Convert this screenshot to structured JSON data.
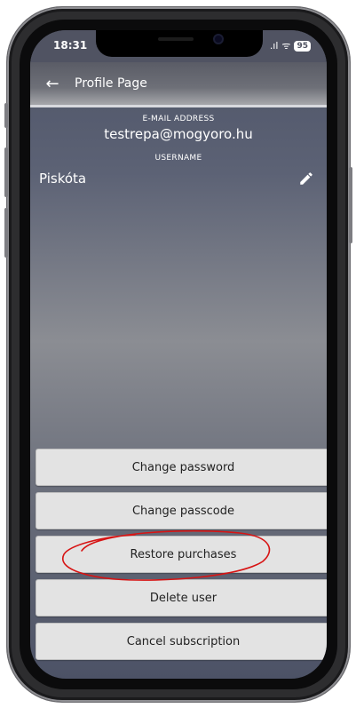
{
  "status_bar": {
    "time": "18:31",
    "signal": ".ıl",
    "wifi": "ᯤ",
    "battery": "95"
  },
  "app_bar": {
    "back_icon": "←",
    "title": "Profile Page"
  },
  "profile": {
    "email_label": "E-MAIL ADDRESS",
    "email": "testrepa@mogyoro.hu",
    "username_label": "USERNAME",
    "username": "Piskóta"
  },
  "actions": [
    {
      "label": "Change password"
    },
    {
      "label": "Change passcode"
    },
    {
      "label": "Restore purchases"
    },
    {
      "label": "Delete user"
    },
    {
      "label": "Cancel subscription"
    }
  ],
  "colors": {
    "annotation": "#d71414",
    "button_bg": "#e3e3e3"
  }
}
